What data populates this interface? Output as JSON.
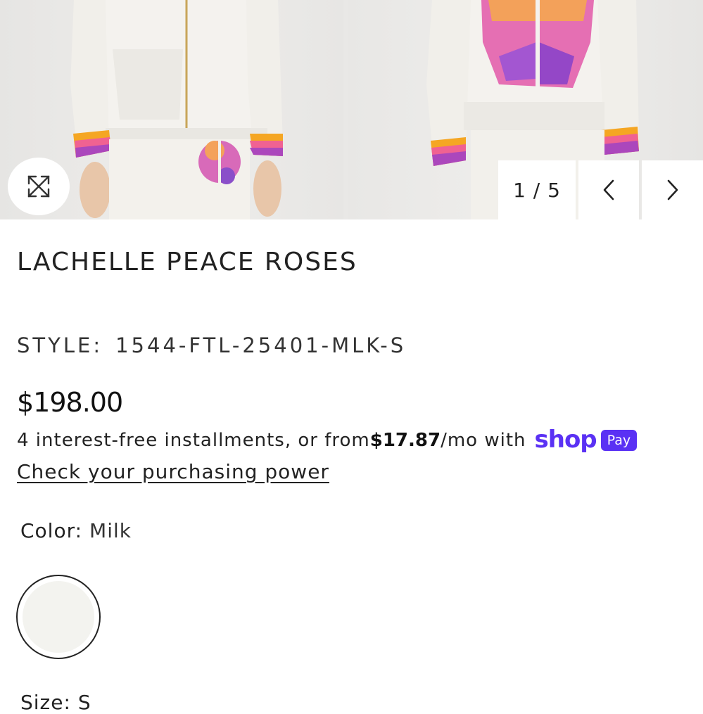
{
  "gallery": {
    "counter": "1 / 5",
    "expand_icon": "expand-arrows-icon",
    "prev_icon": "chevron-left-icon",
    "next_icon": "chevron-right-icon"
  },
  "product": {
    "title": "LACHELLE PEACE ROSES",
    "style_label": "STYLE:",
    "style_value": "1544-FTL-25401-MLK-S",
    "price": "$198.00"
  },
  "installments": {
    "text_before": "4 interest-free installments, or from ",
    "amount": "$17.87",
    "text_after": "/mo with",
    "shop_word": "shop",
    "pay_badge": "Pay",
    "link": "Check your purchasing power"
  },
  "color": {
    "label": "Color:",
    "value": "Milk",
    "swatch_color": "#f3f3ef"
  },
  "size": {
    "label": "Size:",
    "value": "S"
  },
  "colors": {
    "shop_pay_purple": "#5a31f4",
    "text": "#222222"
  }
}
